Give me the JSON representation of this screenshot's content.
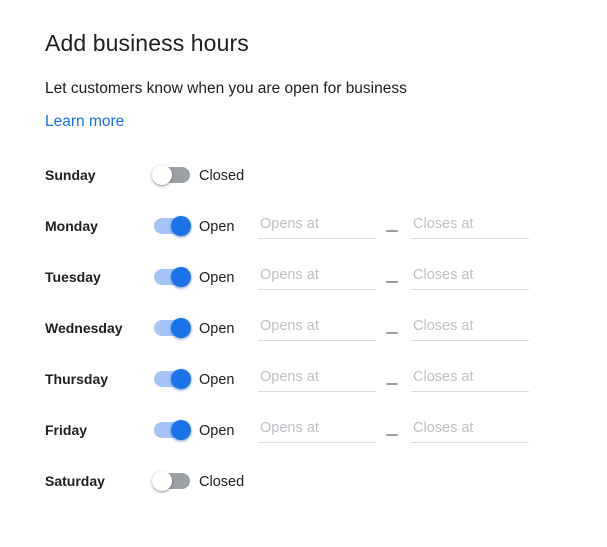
{
  "header": {
    "title": "Add business hours",
    "subtitle": "Let customers know when you are open for business",
    "learn_more_label": "Learn more"
  },
  "labels": {
    "open": "Open",
    "closed": "Closed",
    "opens_at_placeholder": "Opens at",
    "closes_at_placeholder": "Closes at",
    "dash": "–"
  },
  "colors": {
    "link": "#1a73e8",
    "toggle_on_track": "#a6c4f7",
    "toggle_on_knob": "#1a73e8",
    "toggle_off_track": "#9aa0a6",
    "toggle_knob_off": "#ffffff",
    "text_primary": "#202124",
    "placeholder": "#bdc1c6",
    "underline": "#dadce0"
  },
  "days": [
    {
      "name": "Sunday",
      "open": false,
      "state_label": "Closed",
      "show_times": false,
      "opens_at_value": "",
      "closes_at_value": ""
    },
    {
      "name": "Monday",
      "open": true,
      "state_label": "Open",
      "show_times": true,
      "opens_at_value": "",
      "closes_at_value": ""
    },
    {
      "name": "Tuesday",
      "open": true,
      "state_label": "Open",
      "show_times": true,
      "opens_at_value": "",
      "closes_at_value": ""
    },
    {
      "name": "Wednesday",
      "open": true,
      "state_label": "Open",
      "show_times": true,
      "opens_at_value": "",
      "closes_at_value": ""
    },
    {
      "name": "Thursday",
      "open": true,
      "state_label": "Open",
      "show_times": true,
      "opens_at_value": "",
      "closes_at_value": ""
    },
    {
      "name": "Friday",
      "open": true,
      "state_label": "Open",
      "show_times": true,
      "opens_at_value": "",
      "closes_at_value": ""
    },
    {
      "name": "Saturday",
      "open": false,
      "state_label": "Closed",
      "show_times": false,
      "opens_at_value": "",
      "closes_at_value": ""
    }
  ]
}
